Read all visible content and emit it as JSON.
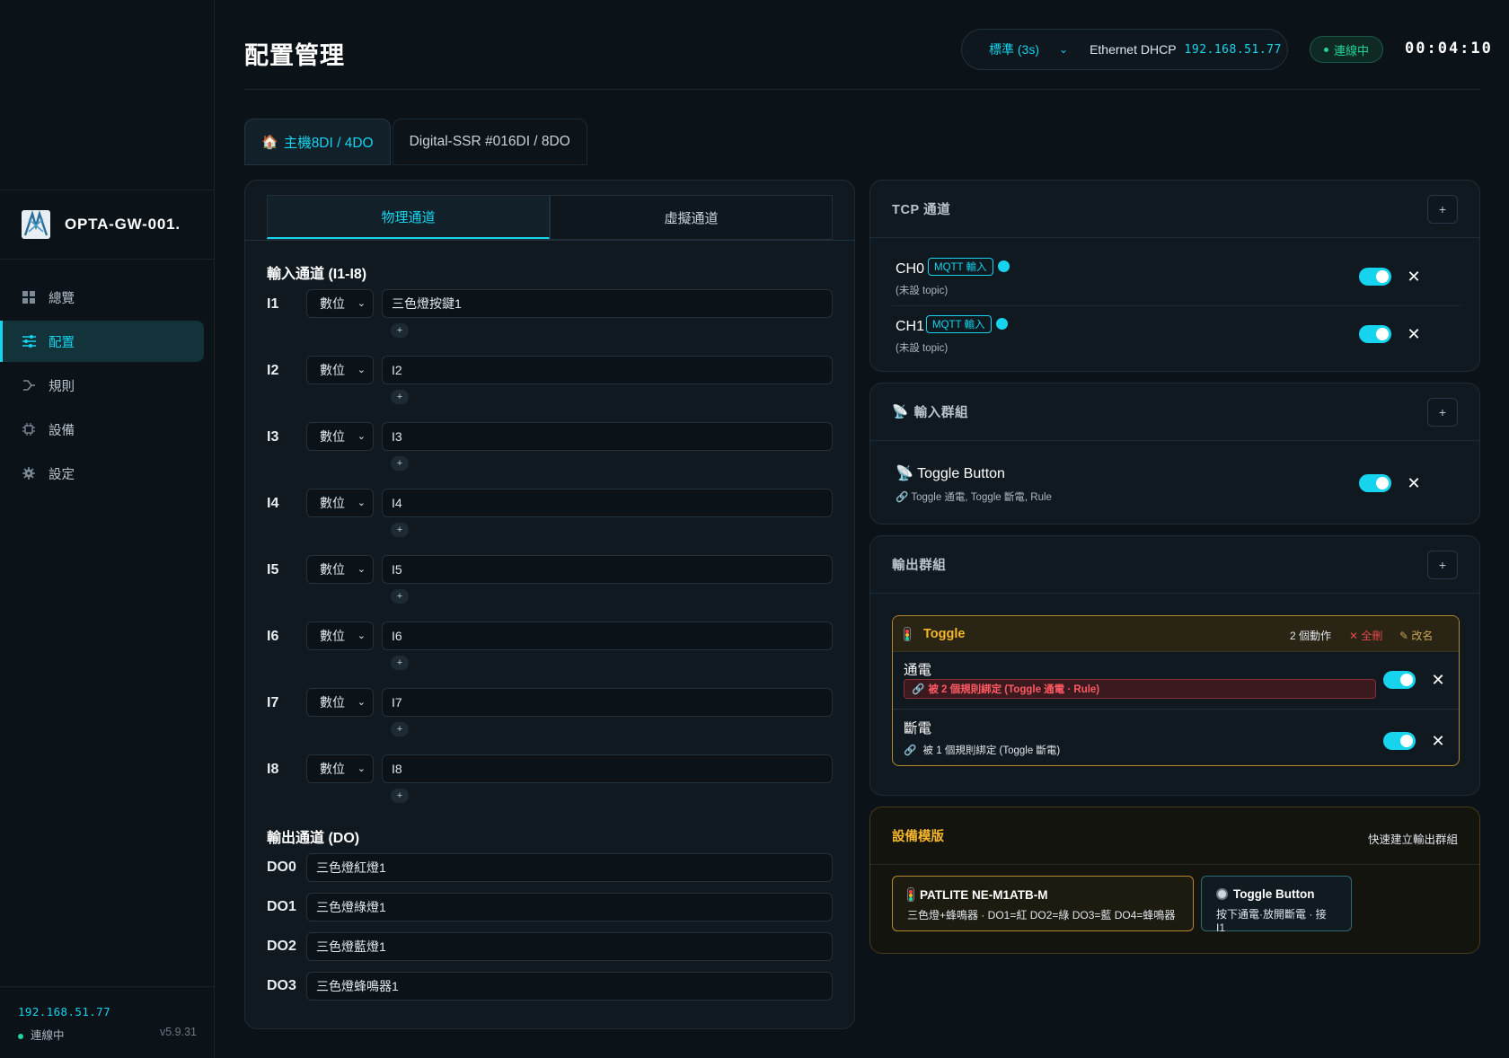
{
  "sidebar": {
    "brand": "OPTA-GW-001.",
    "items": [
      {
        "label": "總覽",
        "icon": "grid-icon"
      },
      {
        "label": "配置",
        "icon": "sliders-icon"
      },
      {
        "label": "規則",
        "icon": "branch-icon"
      },
      {
        "label": "設備",
        "icon": "chip-icon"
      },
      {
        "label": "設定",
        "icon": "gear-icon"
      }
    ],
    "active_index": 1,
    "footer": {
      "ip": "192.168.51.77",
      "status": "連線中",
      "version": "v5.9.31"
    }
  },
  "header": {
    "title": "配置管理",
    "poll_mode": "標準 (3s)",
    "network": "Ethernet DHCP",
    "ip": "192.168.51.77",
    "status": "連線中",
    "uptime": "00:04:10"
  },
  "device_tabs": [
    {
      "label": "主機8DI / 4DO",
      "icon": "house-icon",
      "active": true
    },
    {
      "label": "Digital-SSR #016DI / 8DO",
      "active": false
    }
  ],
  "channel_tabs": [
    "物理通道",
    "虛擬通道"
  ],
  "inputs": {
    "title": "輸入通道 (I1-I8)",
    "rows": [
      {
        "label": "I1",
        "type": "數位",
        "name": "三色燈按鍵1"
      },
      {
        "label": "I2",
        "type": "數位",
        "name": "I2"
      },
      {
        "label": "I3",
        "type": "數位",
        "name": "I3"
      },
      {
        "label": "I4",
        "type": "數位",
        "name": "I4"
      },
      {
        "label": "I5",
        "type": "數位",
        "name": "I5"
      },
      {
        "label": "I6",
        "type": "數位",
        "name": "I6"
      },
      {
        "label": "I7",
        "type": "數位",
        "name": "I7"
      },
      {
        "label": "I8",
        "type": "數位",
        "name": "I8"
      }
    ],
    "add_label": "+"
  },
  "outputs": {
    "title": "輸出通道 (DO)",
    "rows": [
      {
        "label": "DO0",
        "name": "三色燈紅燈1"
      },
      {
        "label": "DO1",
        "name": "三色燈綠燈1"
      },
      {
        "label": "DO2",
        "name": "三色燈藍燈1"
      },
      {
        "label": "DO3",
        "name": "三色燈蜂鳴器1"
      }
    ]
  },
  "tcp": {
    "title": "TCP 通道",
    "add": "+",
    "channels": [
      {
        "name": "CH0",
        "badge": "MQTT 輸入",
        "topic": "(未設 topic)",
        "enabled": true
      },
      {
        "name": "CH1",
        "badge": "MQTT 輸入",
        "topic": "(未設 topic)",
        "enabled": true
      }
    ]
  },
  "input_groups": {
    "title": "輸入群組",
    "add": "+",
    "items": [
      {
        "name": "Toggle Button",
        "bindings": "Toggle 通電, Toggle 斷電, Rule",
        "enabled": true
      }
    ]
  },
  "output_groups": {
    "title": "輸出群組",
    "add": "+",
    "group": {
      "name": "Toggle",
      "count": "2 個動作",
      "delete_all": "✕ 全刪",
      "rename": "✎ 改名",
      "actions": [
        {
          "name": "通電",
          "binding": "被 2 個規則綁定 (Toggle 通電 · Rule)",
          "warn": true,
          "enabled": true
        },
        {
          "name": "斷電",
          "binding": "被 1 個規則綁定 (Toggle 斷電)",
          "warn": false,
          "enabled": true
        }
      ]
    }
  },
  "templates": {
    "title": "設備模版",
    "quick": "快速建立輸出群組",
    "items": [
      {
        "name": "PATLITE NE-M1ATB-M",
        "desc": "三色燈+蜂鳴器 · DO1=紅 DO2=綠 DO3=藍 DO4=蜂鳴器"
      },
      {
        "name": "Toggle Button",
        "desc": "按下通電·放開斷電 · 接 I1"
      }
    ]
  },
  "colors": {
    "accent": "#16d4ee",
    "ok": "#22d39b",
    "warn": "#f4b72b",
    "danger": "#e5484d"
  }
}
